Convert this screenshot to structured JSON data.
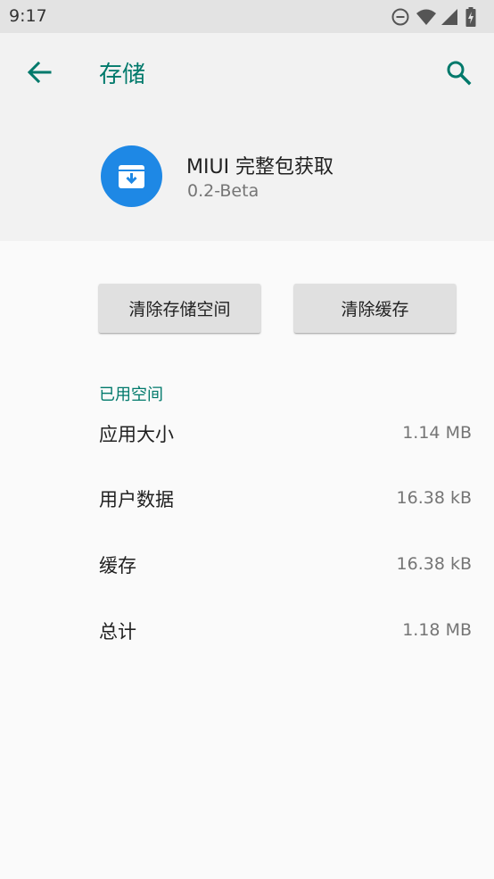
{
  "status_bar": {
    "time": "9:17",
    "icons": [
      "do-not-disturb-icon",
      "wifi-icon",
      "signal-icon",
      "battery-charging-icon"
    ]
  },
  "header": {
    "title": "存储",
    "back_icon": "arrow-back-icon",
    "search_icon": "search-icon"
  },
  "app": {
    "name": "MIUI 完整包获取",
    "version": "0.2-Beta",
    "icon": "archive-download-icon",
    "icon_color": "#1e88e5"
  },
  "buttons": {
    "clear_storage": "清除存储空间",
    "clear_cache": "清除缓存"
  },
  "section": {
    "title": "已用空间",
    "rows": [
      {
        "label": "应用大小",
        "value": "1.14 MB"
      },
      {
        "label": "用户数据",
        "value": "16.38 kB"
      },
      {
        "label": "缓存",
        "value": "16.38 kB"
      },
      {
        "label": "总计",
        "value": "1.18 MB"
      }
    ]
  },
  "colors": {
    "accent": "#00796b",
    "status_bar": "#e3e3e3",
    "header_bg": "#f2f2f2",
    "body_bg": "#fafafa"
  }
}
